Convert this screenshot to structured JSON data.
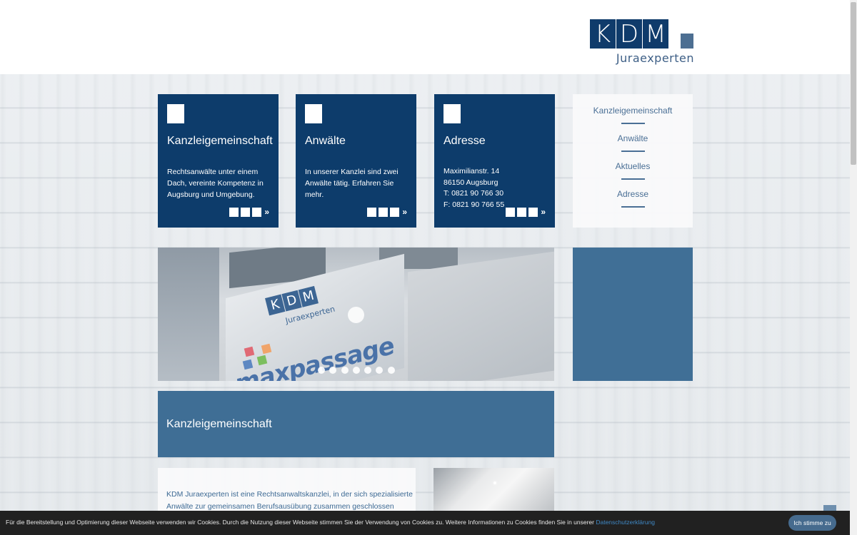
{
  "header": {
    "logo": {
      "letters": [
        "K",
        "D",
        "M"
      ],
      "subtitle": "Juraexperten"
    }
  },
  "tiles": [
    {
      "title": "Kanzleigemeinschaft",
      "text": "Rechtsanwälte unter einem Dach, vereinte Kompetenz in Augsburg und Umgebung.",
      "more": "»"
    },
    {
      "title": "Anwälte",
      "text": "In unserer Kanzlei sind zwei Anwälte tätig. Erfahren Sie mehr.",
      "more": "»"
    },
    {
      "title": "Adresse",
      "lines": [
        "Maximilianstr. 14",
        "86150 Augsburg",
        "T: 0821 90 766 30",
        "F: 0821 90 766 55"
      ],
      "more": "»"
    }
  ],
  "nav": {
    "items": [
      "Kanzleigemeinschaft",
      "Anwälte",
      "Aktuelles",
      "Adresse"
    ]
  },
  "slider": {
    "sign_letters": [
      "K",
      "D",
      "M"
    ],
    "sign_subtitle": "Juraexperten",
    "building_text": "maxpassage",
    "dot_count": 7,
    "active_dot": 7
  },
  "section": {
    "title": "Kanzleigemeinschaft",
    "intro": "KDM Juraexperten ist eine Rechtsanwaltskanzlei, in der sich spezialisierte Anwälte zur gemeinsamen Berufsausübung zusammen geschlossen haben."
  },
  "cookie": {
    "text": "Für die Bereitstellung und Optimierung dieser Webseite verwenden wir Cookies. Durch die Nutzung dieser Webseite stimmen Sie der Verwendung von Cookies zu. Weitere Informationen zu Cookies finden Sie in unserer ",
    "link": "Datenschutzerklärung",
    "button": "Ich stimme zu"
  },
  "colors": {
    "brand_dark": "#0d3c6b",
    "brand_mid": "#3f6e95",
    "nav_text": "#4a6f95"
  }
}
